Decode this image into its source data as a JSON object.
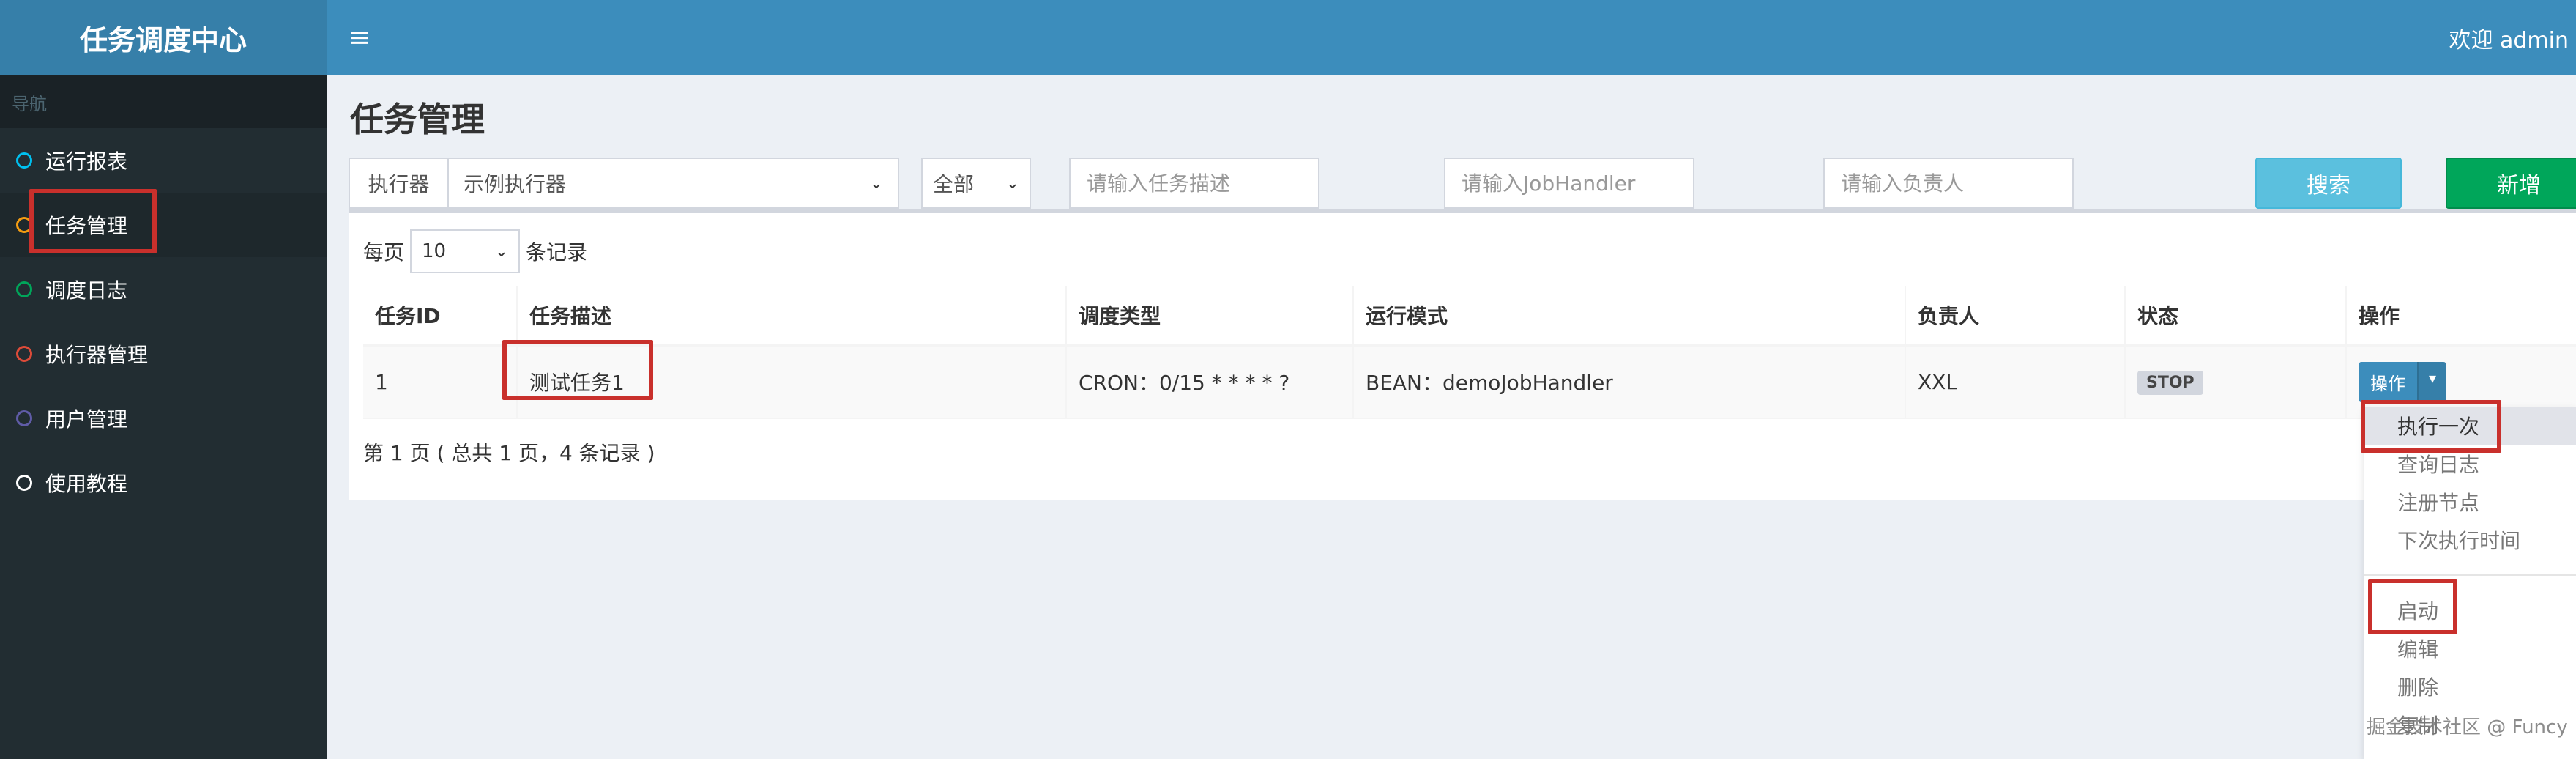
{
  "app": {
    "logo": "任务调度中心",
    "welcome": "欢迎 admin",
    "menu_icon": "≡"
  },
  "sidebar": {
    "header": "导航",
    "items": [
      {
        "label": "运行报表",
        "color": "#00c0ef"
      },
      {
        "label": "任务管理",
        "color": "#f39c12"
      },
      {
        "label": "调度日志",
        "color": "#00a65a"
      },
      {
        "label": "执行器管理",
        "color": "#dd4b39"
      },
      {
        "label": "用户管理",
        "color": "#605ca8"
      },
      {
        "label": "使用教程",
        "color": "#ffffff"
      }
    ]
  },
  "page": {
    "title": "任务管理"
  },
  "filters": {
    "executor_label": "执行器",
    "executor_value": "示例执行器",
    "status_value": "全部",
    "desc_placeholder": "请输入任务描述",
    "handler_placeholder": "请输入JobHandler",
    "author_placeholder": "请输入负责人",
    "search_label": "搜索",
    "add_label": "新增"
  },
  "table": {
    "per_page_prefix": "每页",
    "per_page_value": "10",
    "per_page_suffix": "条记录",
    "headers": [
      "任务ID",
      "任务描述",
      "调度类型",
      "运行模式",
      "负责人",
      "状态",
      "操作"
    ],
    "rows": [
      {
        "id": "1",
        "desc": "测试任务1",
        "schedule": "CRON：0/15 * * * * ?",
        "mode": "BEAN：demoJobHandler",
        "author": "XXL",
        "status": "STOP",
        "op_label": "操作"
      }
    ],
    "page_info": "第 1 页 ( 总共 1 页，4 条记录 )"
  },
  "dropdown": {
    "group1": [
      "执行一次",
      "查询日志",
      "注册节点",
      "下次执行时间"
    ],
    "group2": [
      "启动",
      "编辑",
      "删除",
      "复制"
    ]
  },
  "watermark": "掘金技术社区 @ Funcy",
  "colors": {
    "header": "#3c8dbc",
    "logo": "#367fa9",
    "sidebar": "#222d32",
    "highlight": "#c9302c"
  }
}
